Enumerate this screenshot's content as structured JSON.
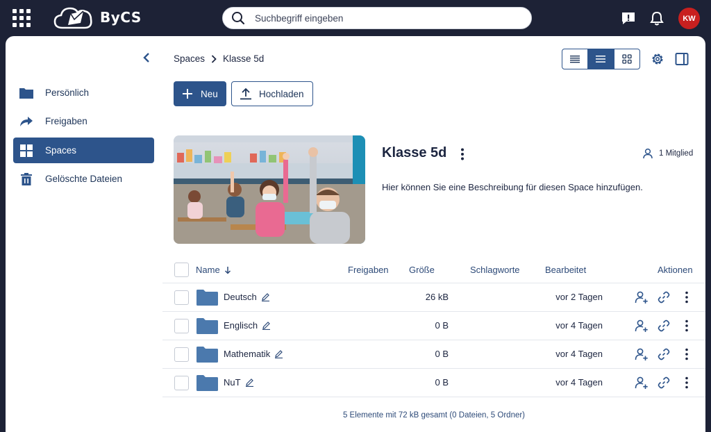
{
  "app": {
    "logo_text": "ByCS",
    "search_placeholder": "Suchbegriff eingeben",
    "avatar_initials": "KW",
    "accent_color": "#2d548b",
    "avatar_color": "#c8201f"
  },
  "sidebar": {
    "items": [
      {
        "label": "Persönlich",
        "icon": "folder-icon"
      },
      {
        "label": "Freigaben",
        "icon": "share-icon"
      },
      {
        "label": "Spaces",
        "icon": "grid-icon",
        "active": true
      },
      {
        "label": "Gelöschte Dateien",
        "icon": "trash-icon"
      }
    ]
  },
  "breadcrumb": {
    "root": "Spaces",
    "current": "Klasse 5d"
  },
  "toolbar": {
    "new_label": "Neu",
    "upload_label": "Hochladen"
  },
  "space": {
    "title": "Klasse 5d",
    "members": "1 Mitglied",
    "description": "Hier können Sie eine Beschreibung für diesen Space hinzufügen."
  },
  "table": {
    "headers": {
      "name": "Name",
      "shares": "Freigaben",
      "size": "Größe",
      "tags": "Schlagworte",
      "edited": "Bearbeitet",
      "actions": "Aktionen"
    },
    "rows": [
      {
        "name": "Deutsch",
        "size": "26 kB",
        "edited": "vor 2 Tagen"
      },
      {
        "name": "Englisch",
        "size": "0 B",
        "edited": "vor 4 Tagen"
      },
      {
        "name": "Mathematik",
        "size": "0 B",
        "edited": "vor 4 Tagen"
      },
      {
        "name": "NuT",
        "size": "0 B",
        "edited": "vor 4 Tagen"
      }
    ],
    "summary": "5 Elemente mit 72 kB gesamt (0 Dateien, 5 Ordner)"
  }
}
